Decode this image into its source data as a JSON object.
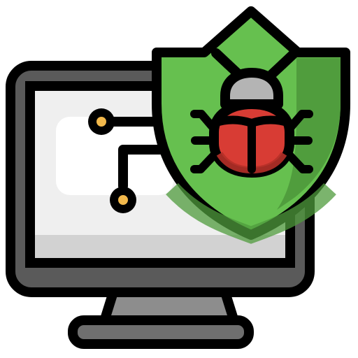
{
  "icon": {
    "name": "antivirus-security-icon",
    "parts": {
      "monitor": "monitor-icon",
      "circuit": "circuit-icon",
      "shield": "shield-icon",
      "bug": "bug-icon"
    }
  },
  "colors": {
    "outline": "#000000",
    "monitor_frame": "#5a5a5a",
    "screen": "#efefef",
    "screen_panel": "#ffffff",
    "screen_bottom": "#d2d2d2",
    "stand": "#8d8d8d",
    "base": "#6f6f6f",
    "node": "#f2b84b",
    "shield_light": "#66c04f",
    "shield_dark": "#4f9b3c",
    "bug_head": "#b4b4b4",
    "bug_body": "#d83c34",
    "bug_body_dark": "#b63028"
  }
}
